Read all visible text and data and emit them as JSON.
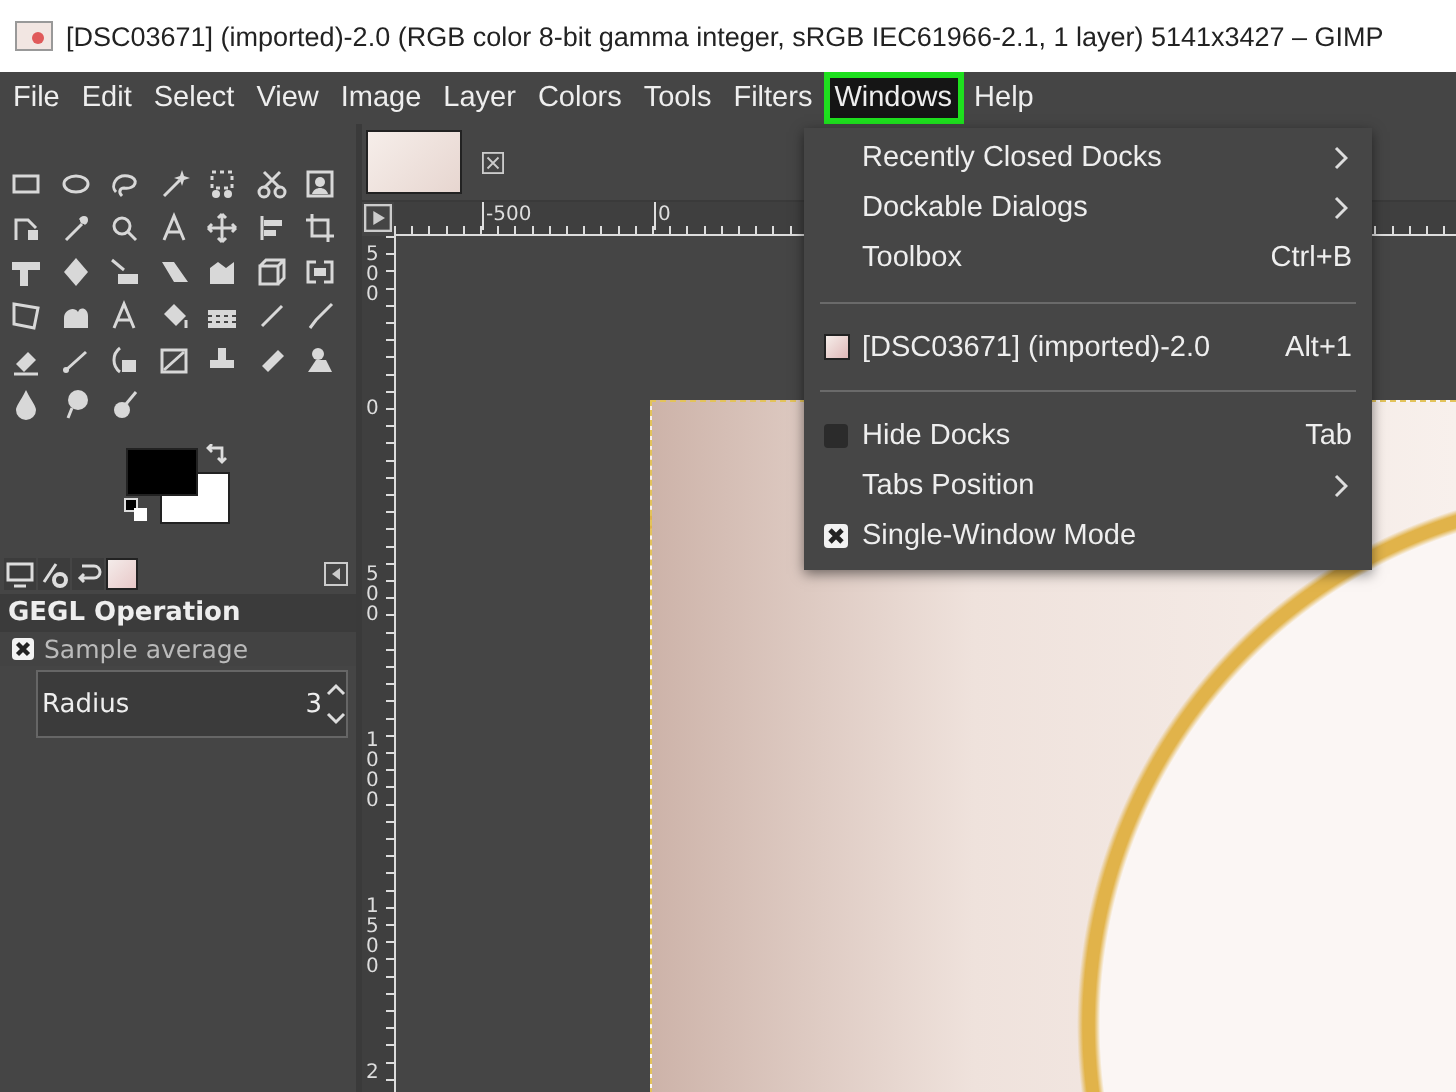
{
  "window": {
    "title": "[DSC03671] (imported)-2.0 (RGB color 8-bit gamma integer, sRGB IEC61966-2.1, 1 layer) 5141x3427 – GIMP"
  },
  "menubar": [
    {
      "label": "File",
      "selected": false
    },
    {
      "label": "Edit",
      "selected": false
    },
    {
      "label": "Select",
      "selected": false
    },
    {
      "label": "View",
      "selected": false
    },
    {
      "label": "Image",
      "selected": false
    },
    {
      "label": "Layer",
      "selected": false
    },
    {
      "label": "Colors",
      "selected": false
    },
    {
      "label": "Tools",
      "selected": false
    },
    {
      "label": "Filters",
      "selected": false
    },
    {
      "label": "Windows",
      "selected": true
    },
    {
      "label": "Help",
      "selected": false
    }
  ],
  "windows_menu": {
    "items": [
      {
        "kind": "submenu",
        "label": "Recently Closed Docks"
      },
      {
        "kind": "submenu",
        "label": "Dockable Dialogs"
      },
      {
        "kind": "action",
        "label": "Toolbox",
        "shortcut": "Ctrl+B"
      },
      {
        "kind": "separator"
      },
      {
        "kind": "image",
        "label": "[DSC03671] (imported)-2.0",
        "shortcut": "Alt+1"
      },
      {
        "kind": "separator"
      },
      {
        "kind": "toggle",
        "label": "Hide Docks",
        "shortcut": "Tab",
        "checked": false
      },
      {
        "kind": "submenu",
        "label": "Tabs Position"
      },
      {
        "kind": "toggle",
        "label": "Single-Window Mode",
        "checked": true
      }
    ]
  },
  "tool_options": {
    "title": "GEGL Operation",
    "sample_average": {
      "label": "Sample average",
      "checked": true
    },
    "radius": {
      "label": "Radius",
      "value": "3"
    }
  },
  "rulers": {
    "horizontal": [
      "-500",
      "0"
    ],
    "vertical": [
      "500",
      "0",
      "500",
      "1000",
      "1500",
      "2"
    ]
  }
}
